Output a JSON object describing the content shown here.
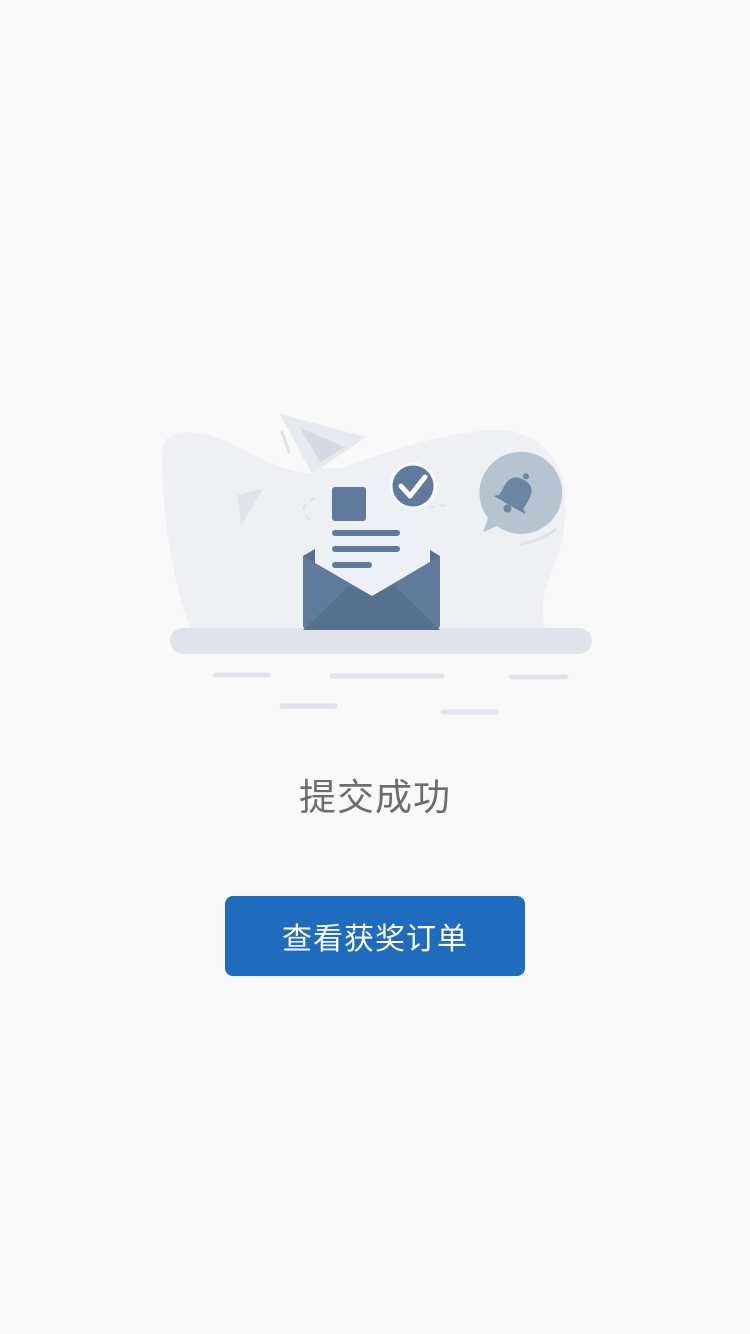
{
  "status": {
    "title": "提交成功"
  },
  "actions": {
    "view_orders_label": "查看获奖订单"
  },
  "icons": {
    "illustration": "submitted-mail-illustration",
    "check": "check-icon",
    "bell": "bell-icon",
    "plane": "paper-plane-icon"
  },
  "colors": {
    "background": "#f9f9fa",
    "primary_button": "#1f6bbd",
    "status_text": "#6d6d6d",
    "envelope": "#5f7a9a",
    "document": "#edf0f4"
  }
}
